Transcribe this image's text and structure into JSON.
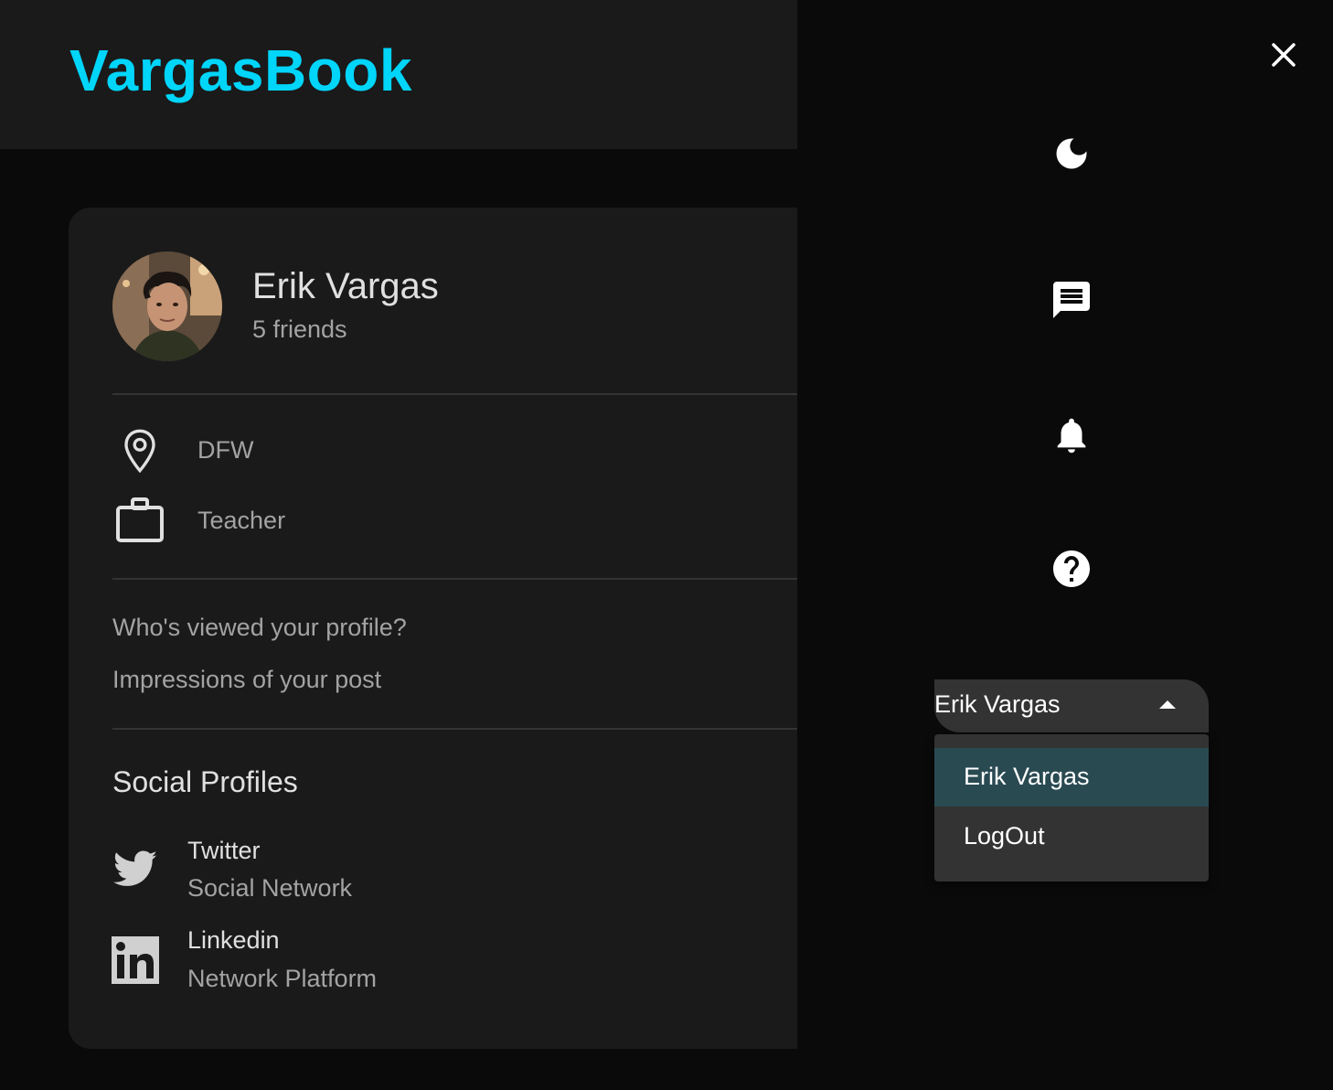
{
  "header": {
    "logo_text": "VargasBook"
  },
  "profile": {
    "name": "Erik Vargas",
    "friends_text": "5 friends",
    "location": "DFW",
    "occupation": "Teacher",
    "stats": [
      {
        "label": "Who's viewed your profile?"
      },
      {
        "label": "Impressions of your post"
      }
    ],
    "social_title": "Social Profiles",
    "socials": [
      {
        "name": "Twitter",
        "type": "Social Network",
        "icon": "twitter-icon"
      },
      {
        "name": "Linkedin",
        "type": "Network Platform",
        "icon": "linkedin-icon"
      }
    ]
  },
  "menu": {
    "icons": [
      "moon-icon",
      "message-icon",
      "bell-icon",
      "help-icon"
    ],
    "user_select": {
      "value": "Erik Vargas",
      "options": [
        {
          "label": "Erik Vargas",
          "selected": true
        },
        {
          "label": "LogOut",
          "selected": false
        }
      ]
    }
  },
  "colors": {
    "brand": "#00d5fa",
    "background": "#0a0a0a",
    "card": "#1a1a1a",
    "selected_option": "#2a4a52"
  }
}
